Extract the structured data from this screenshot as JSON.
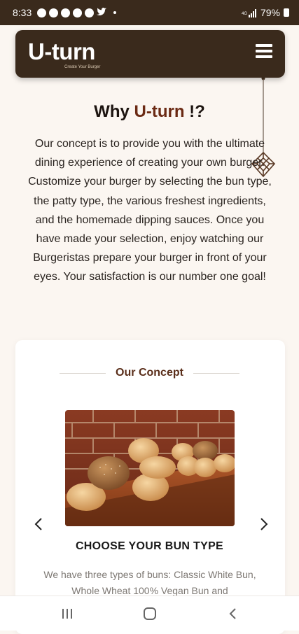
{
  "status_bar": {
    "time": "8:33",
    "battery": "79%"
  },
  "header": {
    "logo_text": "U-turn",
    "logo_tagline": "Create Your Burger"
  },
  "intro": {
    "title_prefix": "Why ",
    "title_brand": "U-turn",
    "title_suffix": " !?",
    "body": "Our concept is to provide you with the ultimate dining experience of creating your own burger. Customize your burger by selecting the bun type, the patty type, the various freshest ingredients, and the homemade dipping sauces. Once you have made your selection, enjoy watching our Burgeristas prepare your burger in front of your eyes. Your satisfaction is our number one goal!"
  },
  "concept": {
    "heading": "Our Concept",
    "slide_title": "CHOOSE YOUR BUN TYPE",
    "slide_text": "We have three types of buns: Classic White Bun, Whole Wheat 100% Vegan Bun and"
  },
  "colors": {
    "brand_dark": "#3a2a1c",
    "brand_accent": "#6b2a14"
  },
  "icons": {
    "menu": "hamburger-menu-icon",
    "prev": "chevron-left-icon",
    "next": "chevron-right-icon",
    "nav_recent": "recent-apps-icon",
    "nav_home": "home-icon",
    "nav_back": "back-icon"
  }
}
